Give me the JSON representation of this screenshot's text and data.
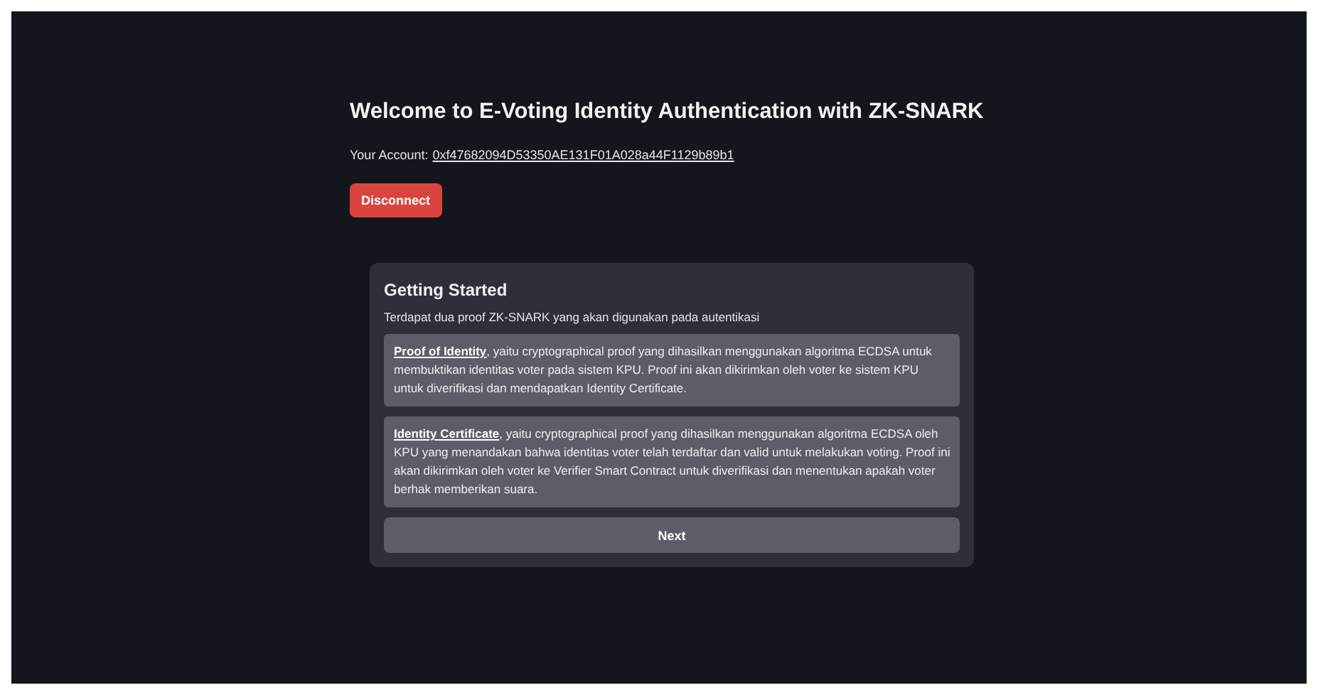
{
  "heading": "Welcome to E-Voting Identity Authentication with ZK-SNARK",
  "account": {
    "label": "Your Account:",
    "address": "0xf47682094D53350AE131F01A028a44F1129b89b1"
  },
  "disconnect_button": "Disconnect",
  "card": {
    "title": "Getting Started",
    "intro": "Terdapat dua proof ZK-SNARK yang akan digunakan pada autentikasi",
    "proofs": [
      {
        "term": "Proof of Identity",
        "text": ", yaitu cryptographical proof yang dihasilkan menggunakan algoritma ECDSA untuk membuktikan identitas voter pada sistem KPU. Proof ini akan dikirimkan oleh voter ke sistem KPU untuk diverifikasi dan mendapatkan Identity Certificate."
      },
      {
        "term": "Identity Certificate",
        "text": ", yaitu cryptographical proof yang dihasilkan menggunakan algoritma ECDSA oleh KPU yang menandakan bahwa identitas voter telah terdaftar dan valid untuk melakukan voting. Proof ini akan dikirimkan oleh voter ke Verifier Smart Contract untuk diverifikasi dan menentukan apakah voter berhak memberikan suara."
      }
    ],
    "next_button": "Next"
  }
}
